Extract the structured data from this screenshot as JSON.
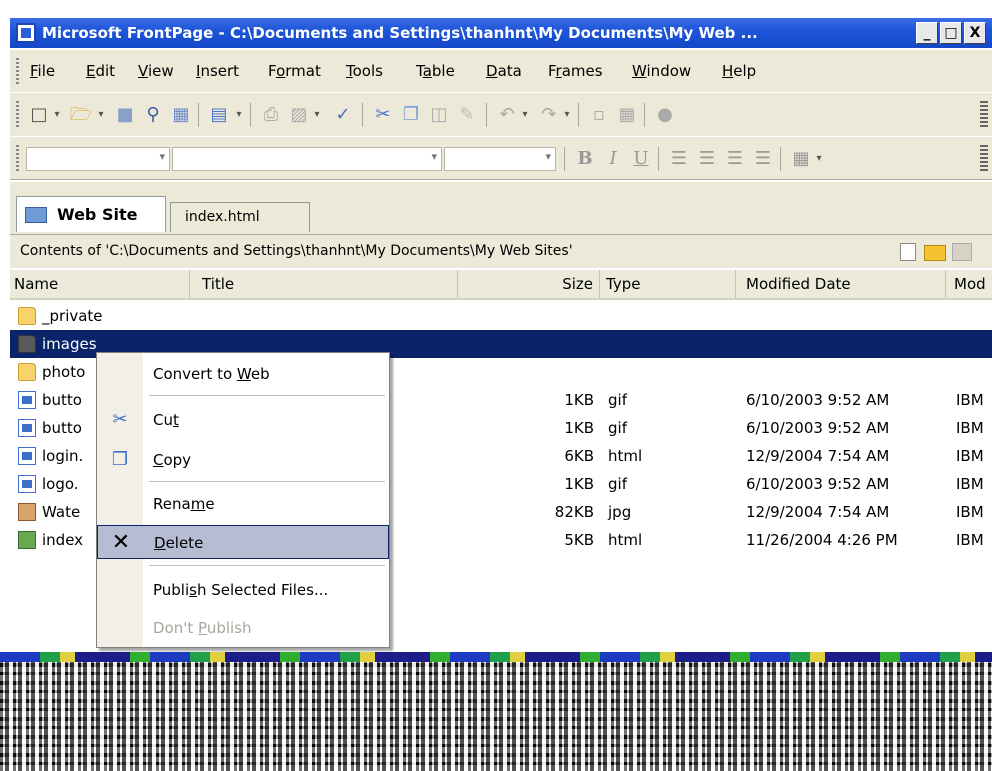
{
  "window": {
    "title": "Microsoft FrontPage - C:\\Documents and Settings\\thanhnt\\My Documents\\My Web ...",
    "minimize": "_",
    "maximize": "□",
    "close": "X"
  },
  "menubar": {
    "items": [
      {
        "pre": "",
        "u": "F",
        "post": "ile"
      },
      {
        "pre": "",
        "u": "E",
        "post": "dit"
      },
      {
        "pre": "",
        "u": "V",
        "post": "iew"
      },
      {
        "pre": "",
        "u": "I",
        "post": "nsert"
      },
      {
        "pre": "F",
        "u": "o",
        "post": "rmat"
      },
      {
        "pre": "",
        "u": "T",
        "post": "ools"
      },
      {
        "pre": "T",
        "u": "a",
        "post": "ble"
      },
      {
        "pre": "",
        "u": "D",
        "post": "ata"
      },
      {
        "pre": "F",
        "u": "r",
        "post": "ames"
      },
      {
        "pre": "",
        "u": "W",
        "post": "indow"
      },
      {
        "pre": "",
        "u": "H",
        "post": "elp"
      }
    ]
  },
  "toolbar2": {
    "bold": "B",
    "italic": "I",
    "underline": "U"
  },
  "tabs": {
    "web_site": "Web Site",
    "index": "index.html"
  },
  "contents": {
    "label": "Contents of 'C:\\Documents and Settings\\thanhnt\\My Documents\\My Web Sites'"
  },
  "columns": {
    "name": "Name",
    "title": "Title",
    "size": "Size",
    "type": "Type",
    "modified": "Modified Date",
    "modby": "Mod"
  },
  "files": [
    {
      "name": "_private",
      "size": "",
      "type": "",
      "date": "",
      "by": ""
    },
    {
      "name": "images",
      "size": "",
      "type": "",
      "date": "",
      "by": ""
    },
    {
      "name": "photo",
      "size": "",
      "type": "",
      "date": "",
      "by": ""
    },
    {
      "name": "butto",
      "size": "1KB",
      "type": "gif",
      "date": "6/10/2003 9:52 AM",
      "by": "IBM"
    },
    {
      "name": "butto",
      "size": "1KB",
      "type": "gif",
      "date": "6/10/2003 9:52 AM",
      "by": "IBM"
    },
    {
      "name": "login.",
      "size": "6KB",
      "type": "html",
      "date": "12/9/2004 7:54 AM",
      "by": "IBM"
    },
    {
      "name": "logo.",
      "size": "1KB",
      "type": "gif",
      "date": "6/10/2003 9:52 AM",
      "by": "IBM"
    },
    {
      "name": "Wate",
      "size": "82KB",
      "type": "jpg",
      "date": "12/9/2004 7:54 AM",
      "by": "IBM"
    },
    {
      "name": "index",
      "size": "5KB",
      "type": "html",
      "date": "11/26/2004 4:26 PM",
      "by": "IBM"
    }
  ],
  "context_menu": {
    "convert": {
      "pre": "Convert to ",
      "u": "W",
      "post": "eb"
    },
    "cut": {
      "pre": "Cu",
      "u": "t",
      "post": ""
    },
    "copy": {
      "pre": "",
      "u": "C",
      "post": "opy"
    },
    "rename": {
      "pre": "Rena",
      "u": "m",
      "post": "e"
    },
    "delete": {
      "pre": "",
      "u": "D",
      "post": "elete"
    },
    "publish": {
      "pre": "Publi",
      "u": "s",
      "post": "h Selected Files..."
    },
    "dont_publish": {
      "pre": "Don't ",
      "u": "P",
      "post": "ublish"
    }
  }
}
